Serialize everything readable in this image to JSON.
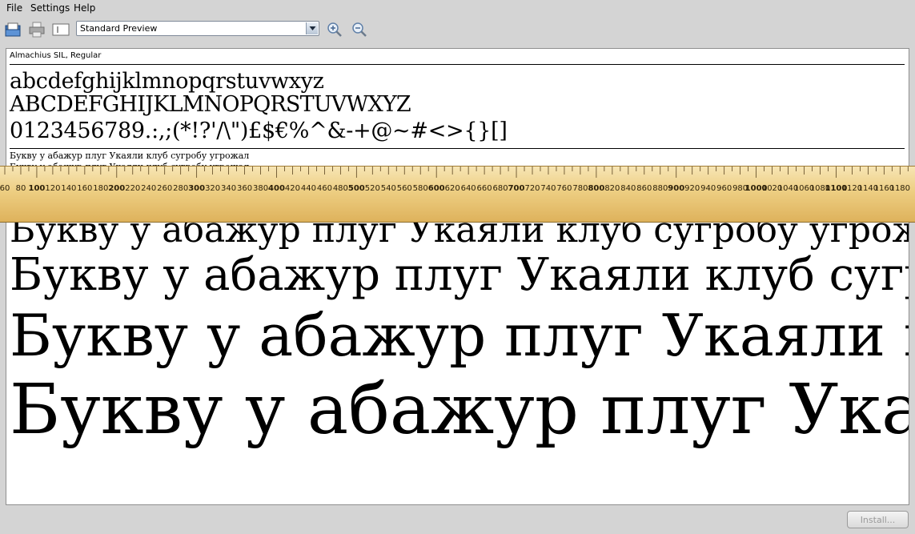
{
  "menu": {
    "file": "File",
    "settings": "Settings",
    "help": "Help"
  },
  "toolbar": {
    "preview_mode": "Standard Preview",
    "icons": [
      "open-icon",
      "print-icon",
      "page-icon",
      "zoom-in-icon",
      "zoom-out-icon"
    ]
  },
  "preview": {
    "font_name": "Almachius SIL, Regular",
    "lowercase": "abcdefghijklmnopqrstuvwxyz",
    "uppercase": "ABCDEFGHIJKLMNOPQRSTUVWXYZ",
    "digits": "0123456789.:,;(*!?'/\\\")£$€%^&-+@~#<>{}[]",
    "sample_text": "Букву у абажур плуг Укаяли клуб сугробу угрожал"
  },
  "ruler": {
    "tick_labels": [
      "60",
      "80",
      "100",
      "120",
      "140",
      "160",
      "180",
      "200",
      "220",
      "240",
      "260",
      "280",
      "300",
      "320",
      "340",
      "360",
      "380",
      "400",
      "420",
      "440",
      "460",
      "480",
      "500",
      "520",
      "540",
      "560",
      "580",
      "600",
      "620",
      "640",
      "660",
      "680",
      "700",
      "720",
      "740",
      "760",
      "780",
      "800",
      "820",
      "840",
      "860",
      "880",
      "900",
      "920",
      "940",
      "960",
      "980",
      "1000",
      "1020",
      "1040",
      "1060",
      "1080",
      "1100",
      "1120",
      "1140",
      "1160",
      "1180"
    ]
  },
  "buttons": {
    "install": "Install..."
  },
  "colors": {
    "ruler_top": "#f7e5b4",
    "ruler_bottom": "#deb25c",
    "window_bg": "#d4d4d4"
  }
}
